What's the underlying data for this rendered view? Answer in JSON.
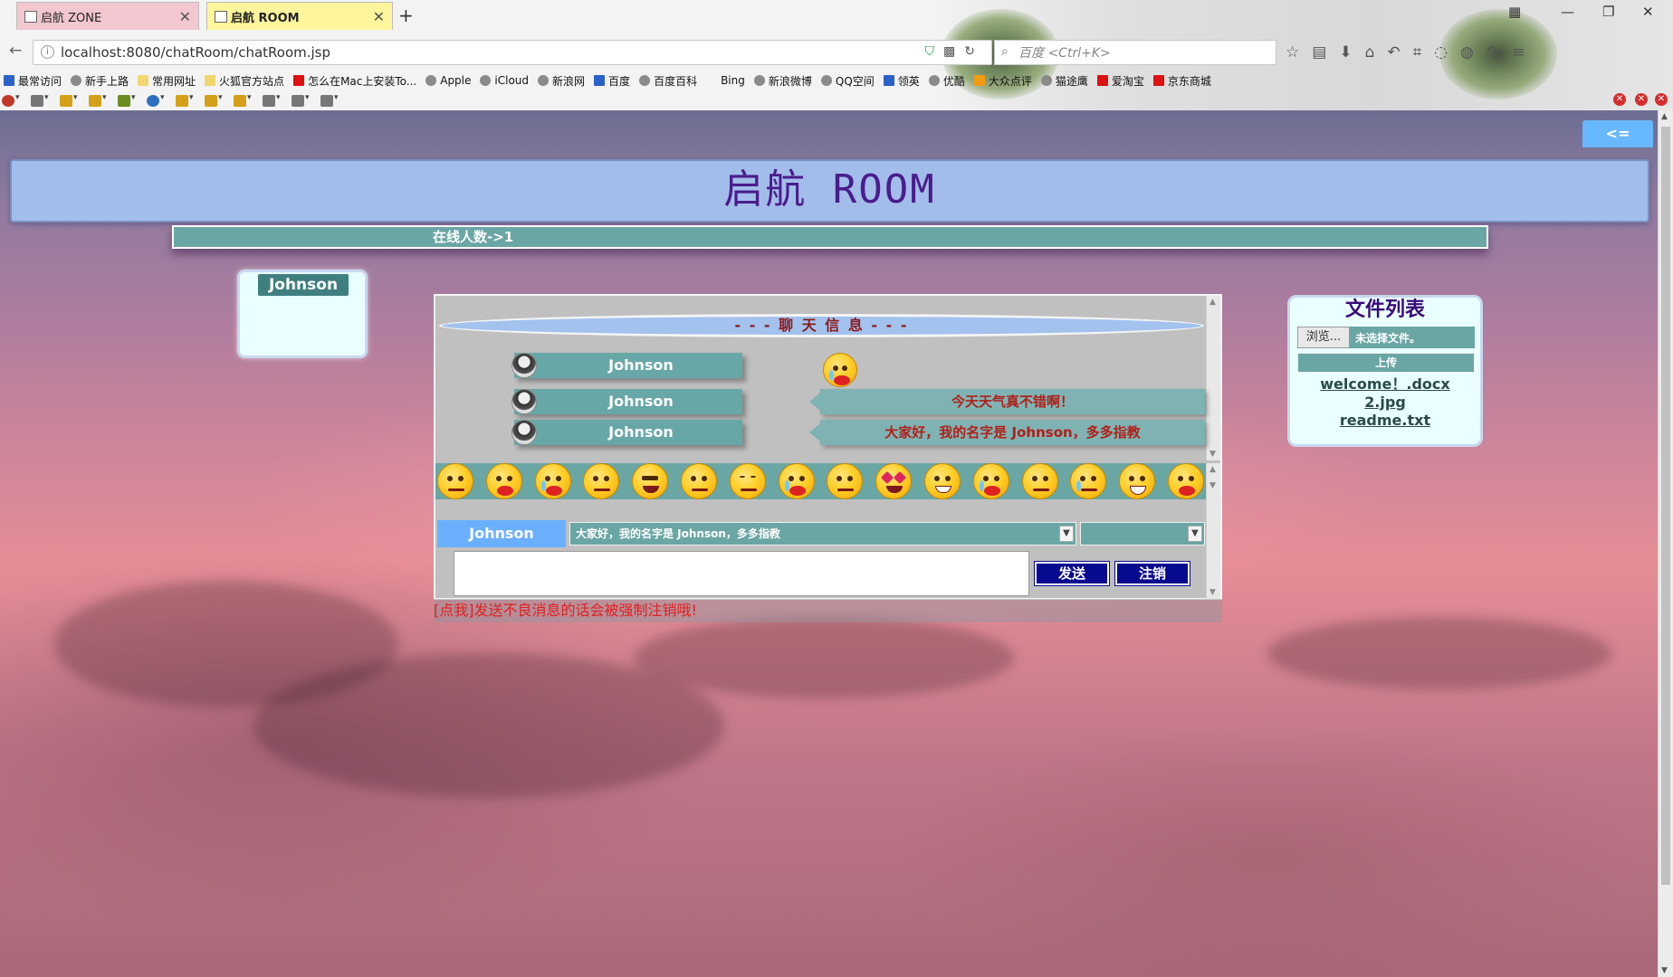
{
  "browser": {
    "tabs": [
      {
        "label": "启航 ZONE",
        "active": false
      },
      {
        "label": "启航 ROOM",
        "active": true
      }
    ],
    "url": "localhost:8080/chatRoom/chatRoom.jsp",
    "search_placeholder": "百度 <Ctrl+K>",
    "bookmarks": [
      "最常访问",
      "新手上路",
      "常用网址",
      "火狐官方站点",
      "怎么在Mac上安装To...",
      "Apple",
      "iCloud",
      "新浪网",
      "百度",
      "百度百科",
      "Bing",
      "新浪微博",
      "QQ空间",
      "领英",
      "优酷",
      "大众点评",
      "猫途鹰",
      "爱淘宝",
      "京东商城"
    ]
  },
  "page": {
    "toggle_label": "<=",
    "title": "启航 ROOM",
    "online_count": "在线人数->1",
    "online_users": [
      "Johnson"
    ],
    "chat": {
      "header": "- - - 聊 天 信 息 - - -",
      "messages": [
        {
          "user": "Johnson",
          "type": "emoji",
          "content": "crying-emoji"
        },
        {
          "user": "Johnson",
          "type": "text",
          "content": "今天天气真不错啊！"
        },
        {
          "user": "Johnson",
          "type": "text",
          "content": "大家好，我的名字是 Johnson，多多指教"
        }
      ],
      "emoji_names": [
        "worried-emoji",
        "angry-emoji",
        "laughing-tears-emoji",
        "sleepy-emoji",
        "cool-emoji",
        "smirk-emoji",
        "sleeping-emoji",
        "crying-emoji",
        "thinking-emoji",
        "heart-eyes-emoji",
        "grin-emoji",
        "sobbing-emoji",
        "dizzy-emoji",
        "sad-emoji",
        "big-grin-emoji",
        "tongue-emoji"
      ],
      "sender_label": "Johnson",
      "selected_phrase": "大家好，我的名字是 Johnson，多多指教",
      "target_selected": "",
      "compose_value": "",
      "send_label": "发送",
      "logout_label": "注销"
    },
    "warning": "[点我]发送不良消息的话会被强制注销哦!",
    "files": {
      "title": "文件列表",
      "browse_label": "浏览...",
      "no_file_label": "未选择文件。",
      "upload_label": "上传",
      "items": [
        "welcome！.docx",
        "2.jpg",
        "readme.txt"
      ]
    }
  }
}
